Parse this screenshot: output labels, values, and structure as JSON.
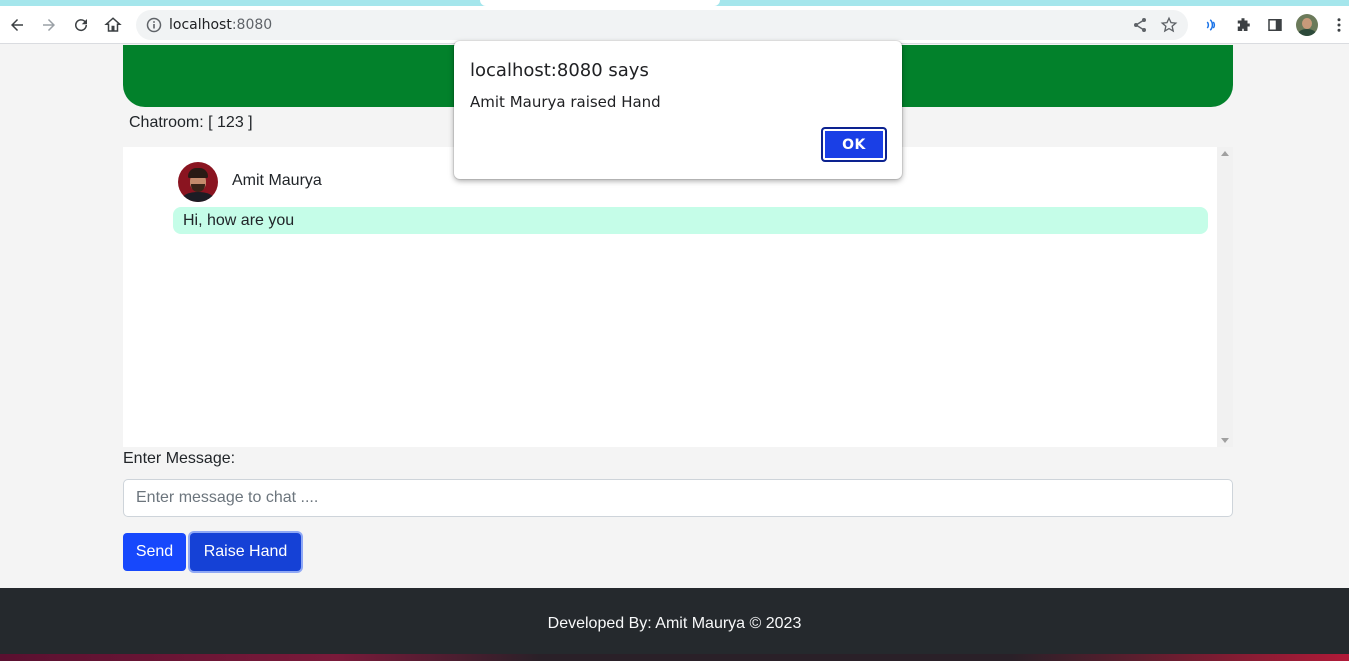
{
  "browser": {
    "url_host": "localhost",
    "url_port": ":8080"
  },
  "page": {
    "chatroom_label": "Chatroom: [ 123 ]",
    "messages": [
      {
        "sender": "Amit Maurya",
        "text": "Hi, how are you"
      }
    ],
    "enter_message_label": "Enter Message:",
    "input_placeholder": "Enter message to chat ....",
    "input_value": "",
    "send_label": "Send",
    "raise_hand_label": "Raise Hand",
    "footer_text": "Developed By: Amit Maurya © 2023"
  },
  "dialog": {
    "title": "localhost:8080 says",
    "message": "Amit Maurya raised Hand",
    "ok_label": "OK"
  },
  "colors": {
    "banner": "#02812b",
    "bubble": "#c5fde8",
    "primary_button": "#1748fc",
    "footer": "#25292d"
  },
  "icons": [
    "back-icon",
    "forward-icon",
    "reload-icon",
    "home-icon",
    "info-icon",
    "share-icon",
    "star-icon",
    "extension-wave-icon",
    "puzzle-icon",
    "sidepanel-icon",
    "profile-avatar",
    "menu-icon"
  ]
}
